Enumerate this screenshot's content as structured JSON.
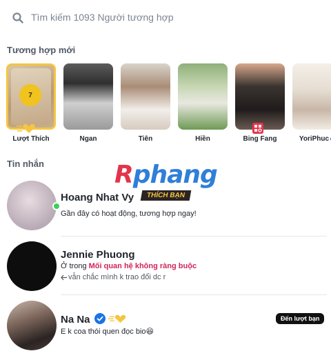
{
  "search": {
    "placeholder": "Tìm kiếm 1093 Người tương hợp"
  },
  "sections": {
    "new_matches": "Tương hợp mới",
    "messages": "Tin nhắn"
  },
  "likes_card": {
    "count": "7",
    "label": "Lượt Thích"
  },
  "matches": [
    {
      "name": "Ngan"
    },
    {
      "name": "Tiên"
    },
    {
      "name": "Hiền"
    },
    {
      "name": "Bing Fang"
    },
    {
      "name": "YoriPhuc"
    }
  ],
  "watermark": {
    "first": "R",
    "rest": "phang"
  },
  "conversations": [
    {
      "name": "Hoang Nhat Vy",
      "badge": "THÍCH BẠN",
      "text": "Gần đây có hoạt động, tương hợp ngay!"
    },
    {
      "name": "Jennie Phuong",
      "status_prefix": "Ở trong ",
      "status_highlight": "Mối quan hệ không ràng buộc",
      "text": "vẫn chắc mình k trao đổi dc r"
    },
    {
      "name": "Na Na",
      "pill": "Đến lượt bạn",
      "text": "E k coa thói quen đọc bio😆"
    }
  ],
  "colors": {
    "gold": "#f5c542",
    "online": "#3ecf57",
    "highlight": "#d1245a",
    "verified": "#1a73e8"
  }
}
